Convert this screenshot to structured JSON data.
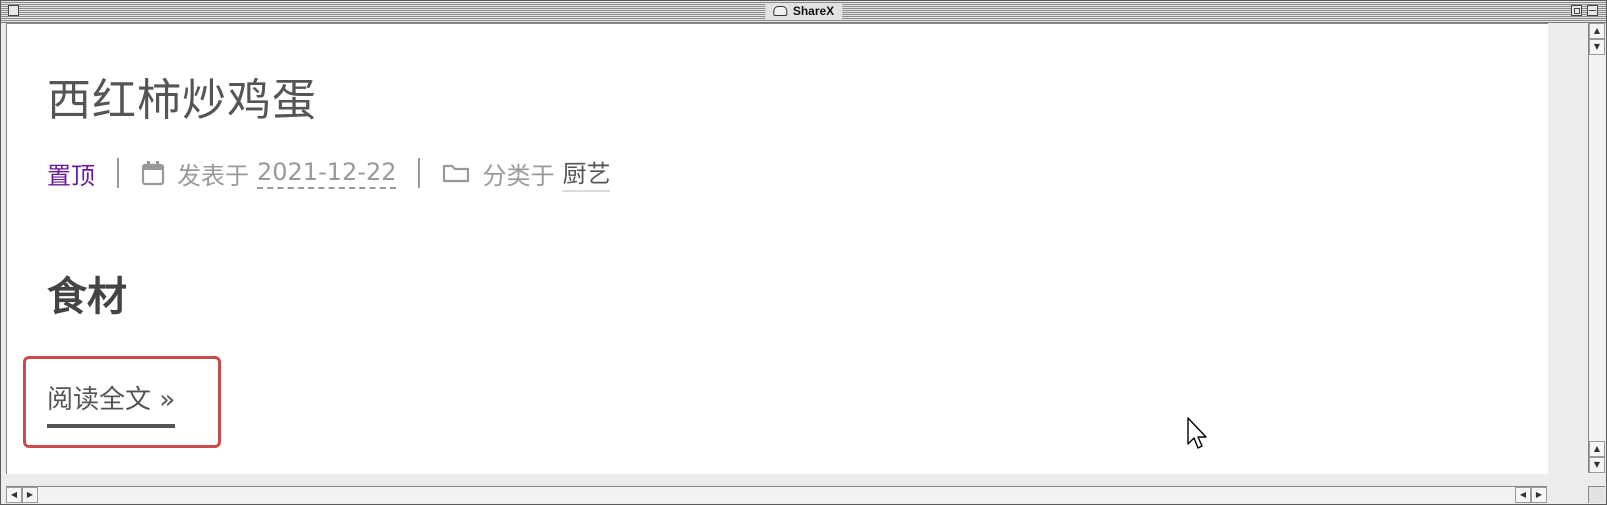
{
  "window": {
    "title": "ShareX"
  },
  "post": {
    "title": "西红柿炒鸡蛋",
    "meta": {
      "sticky": "置顶",
      "posted_label": "发表于",
      "date": "2021-12-22",
      "category_label": "分类于",
      "category": "厨艺"
    },
    "section_heading": "食材",
    "read_more": "阅读全文 »"
  },
  "icons": {
    "calendar": "calendar-icon",
    "folder": "folder-icon",
    "cursor": "mouse-pointer-icon"
  },
  "colors": {
    "sticky": "#6a1b9a",
    "highlight_box": "#c94c4c",
    "text_muted": "#999999",
    "text_dark": "#555555"
  }
}
